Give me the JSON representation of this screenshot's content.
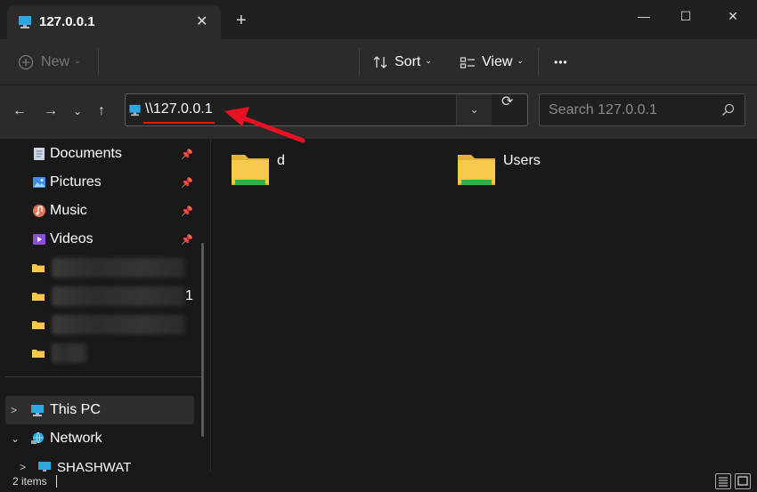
{
  "window": {
    "tab_title": "127.0.0.1",
    "tab_close": "✕",
    "new_tab": "+",
    "minimize": "—",
    "maximize": "☐",
    "close": "✕"
  },
  "toolbar": {
    "new_label": "New",
    "sort_label": "Sort",
    "view_label": "View",
    "more_label": "•••",
    "chevron": "⌄"
  },
  "address": {
    "path": "\\\\127.0.0.1",
    "dropdown": "⌄",
    "search_placeholder": "Search 127.0.0.1"
  },
  "sidebar": {
    "quick_access": [
      {
        "label": "Documents",
        "icon": "documents-icon",
        "pinned": true
      },
      {
        "label": "Pictures",
        "icon": "pictures-icon",
        "pinned": true
      },
      {
        "label": "Music",
        "icon": "music-icon",
        "pinned": true
      },
      {
        "label": "Videos",
        "icon": "videos-icon",
        "pinned": true
      }
    ],
    "blurred_suffix": "1",
    "this_pc": "This PC",
    "network": "Network",
    "network_child": "SHASHWAT"
  },
  "files": [
    {
      "name": "d"
    },
    {
      "name": "Users"
    }
  ],
  "status": {
    "item_count": "2 items"
  },
  "colors": {
    "accent_red": "#e81123",
    "folder_yellow": "#f6c94a",
    "folder_green": "#2fb34a"
  }
}
